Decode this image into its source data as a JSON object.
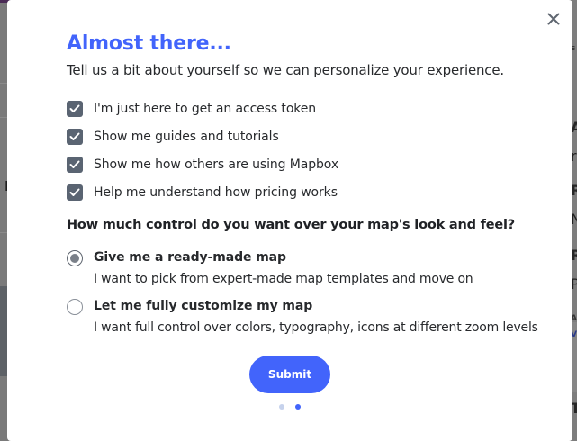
{
  "modal": {
    "title": "Almost there...",
    "subtitle": "Tell us a bit about yourself so we can personalize your experience.",
    "checkboxes": [
      {
        "label": "I'm just here to get an access token",
        "checked": true
      },
      {
        "label": "Show me guides and tutorials",
        "checked": true
      },
      {
        "label": "Show me how others are using Mapbox",
        "checked": true
      },
      {
        "label": "Help me understand how pricing works",
        "checked": true
      }
    ],
    "question": "How much control do you want over your map's look and feel?",
    "options": [
      {
        "title": "Give me a ready-made map",
        "description": "I want to pick from expert-made map templates and move on",
        "selected": true
      },
      {
        "title": "Let me fully customize my map",
        "description": "I want full control over colors, typography, icons at different zoom levels",
        "selected": false
      }
    ],
    "submit_label": "Submit",
    "pager": {
      "total": 2,
      "current": 2
    }
  },
  "background": {
    "right_fragments": [
      "s",
      "A",
      "r",
      "R",
      "N",
      "R",
      "P",
      "A",
      "V",
      "T"
    ],
    "left_fragment": "I"
  },
  "colors": {
    "accent": "#4264fb",
    "checkbox_fill": "#5a6472",
    "text": "#27292c",
    "overlay": "#7a7a7a"
  },
  "icons": {
    "close": "close-icon",
    "check": "check-icon"
  }
}
